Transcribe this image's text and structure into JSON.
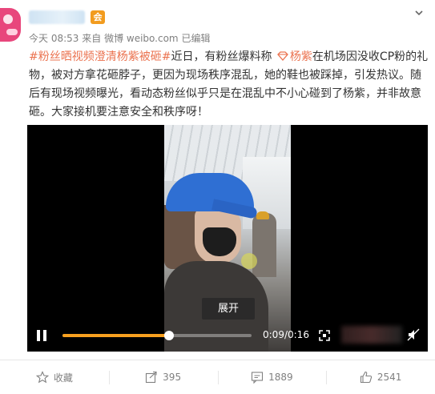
{
  "post": {
    "meta": {
      "time": "今天 08:53",
      "source_prefix": "来自",
      "source": "微博 weibo.com",
      "edited": "已编辑"
    },
    "vip_label": "会",
    "text": {
      "topic": "#粉丝晒视频澄清杨紫被砸#",
      "part1": "近日，有粉丝爆料称",
      "mention": "杨紫",
      "part2": "在机场因没收CP粉的礼物，被对方拿花砸脖子，更因为现场秩序混乱，她的鞋也被踩掉，引发热议。随后有现场视频曝光，看动态粉丝似乎只是在混乱中不小心碰到了杨紫，并非故意砸。大家接机要注意安全和秩序呀！"
    }
  },
  "video": {
    "expand_label": "展开",
    "current_time": "0:09",
    "duration": "0:16",
    "progress": 0.5625
  },
  "actions": {
    "favorite": "收藏",
    "repost": "395",
    "comment": "1889",
    "like": "2541"
  },
  "colors": {
    "accent": "#eb7350",
    "progress": "#f7a01f",
    "avatar": "#e8467c"
  }
}
